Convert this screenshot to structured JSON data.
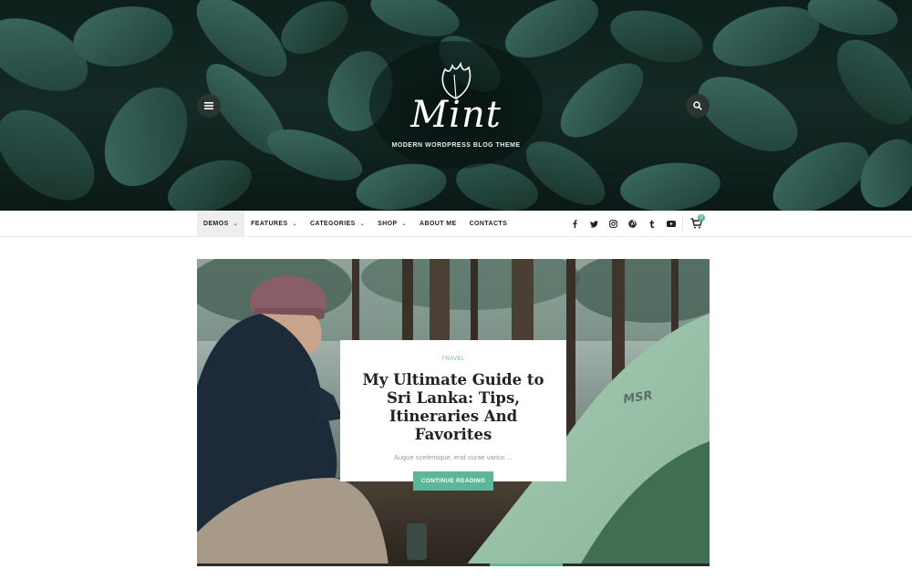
{
  "hero": {
    "logo_text": "Mint",
    "tagline": "Modern WordPress Blog Theme",
    "menu_icon": "hamburger-icon",
    "search_icon": "search-icon"
  },
  "nav": {
    "items": [
      {
        "label": "Demos",
        "has_dropdown": true,
        "active": true
      },
      {
        "label": "Features",
        "has_dropdown": true
      },
      {
        "label": "Categories",
        "has_dropdown": true
      },
      {
        "label": "Shop",
        "has_dropdown": true
      },
      {
        "label": "About Me"
      },
      {
        "label": "Contacts"
      }
    ],
    "social": [
      "facebook-icon",
      "twitter-icon",
      "instagram-icon",
      "pinterest-icon",
      "tumblr-icon",
      "youtube-icon"
    ],
    "cart_count": "0"
  },
  "featured": {
    "category": "Travel",
    "title": "My Ultimate Guide to Sri Lanka: Tips, Itineraries And Favorites",
    "excerpt": "Augue scelerisque, erat curae varius ...",
    "button_label": "Continue Reading",
    "tent_brand": "MSR"
  },
  "colors": {
    "accent": "#5cb79a",
    "hero_dark": "#0d1f1b",
    "leaf": "#2f5a50"
  }
}
